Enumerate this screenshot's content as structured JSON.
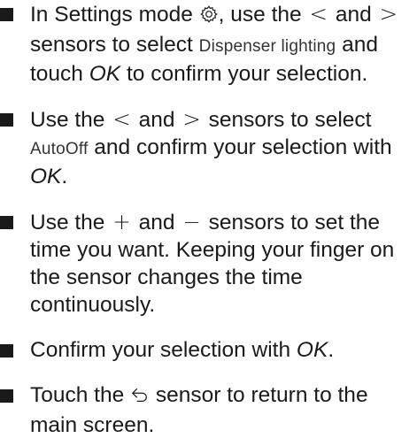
{
  "steps": [
    {
      "a": "In Settings mode",
      "b": ", use the",
      "lt": "<",
      "c": "and",
      "gt": ">",
      "d": "sensors to select",
      "display": "Dispenser lighting",
      "e": "and touch",
      "ok": "OK",
      "f": "to confirm your selection.",
      "icon": "gear-icon"
    },
    {
      "a": "Use the",
      "lt": "<",
      "b": "and",
      "gt": ">",
      "c": "sensors to select",
      "display": "AutoOff",
      "d": "and confirm your selection with",
      "ok": "OK",
      "e": "."
    },
    {
      "a": "Use the",
      "plus": "+",
      "b": "and",
      "minus": "−",
      "c": "sensors to set the time you want. Keeping your finger on the sensor changes the time continuously."
    },
    {
      "a": "Confirm your selection with",
      "ok": "OK",
      "b": "."
    },
    {
      "a": "Touch the",
      "b": "sensor to return to the main screen.",
      "icon": "back-arrow-icon"
    }
  ]
}
